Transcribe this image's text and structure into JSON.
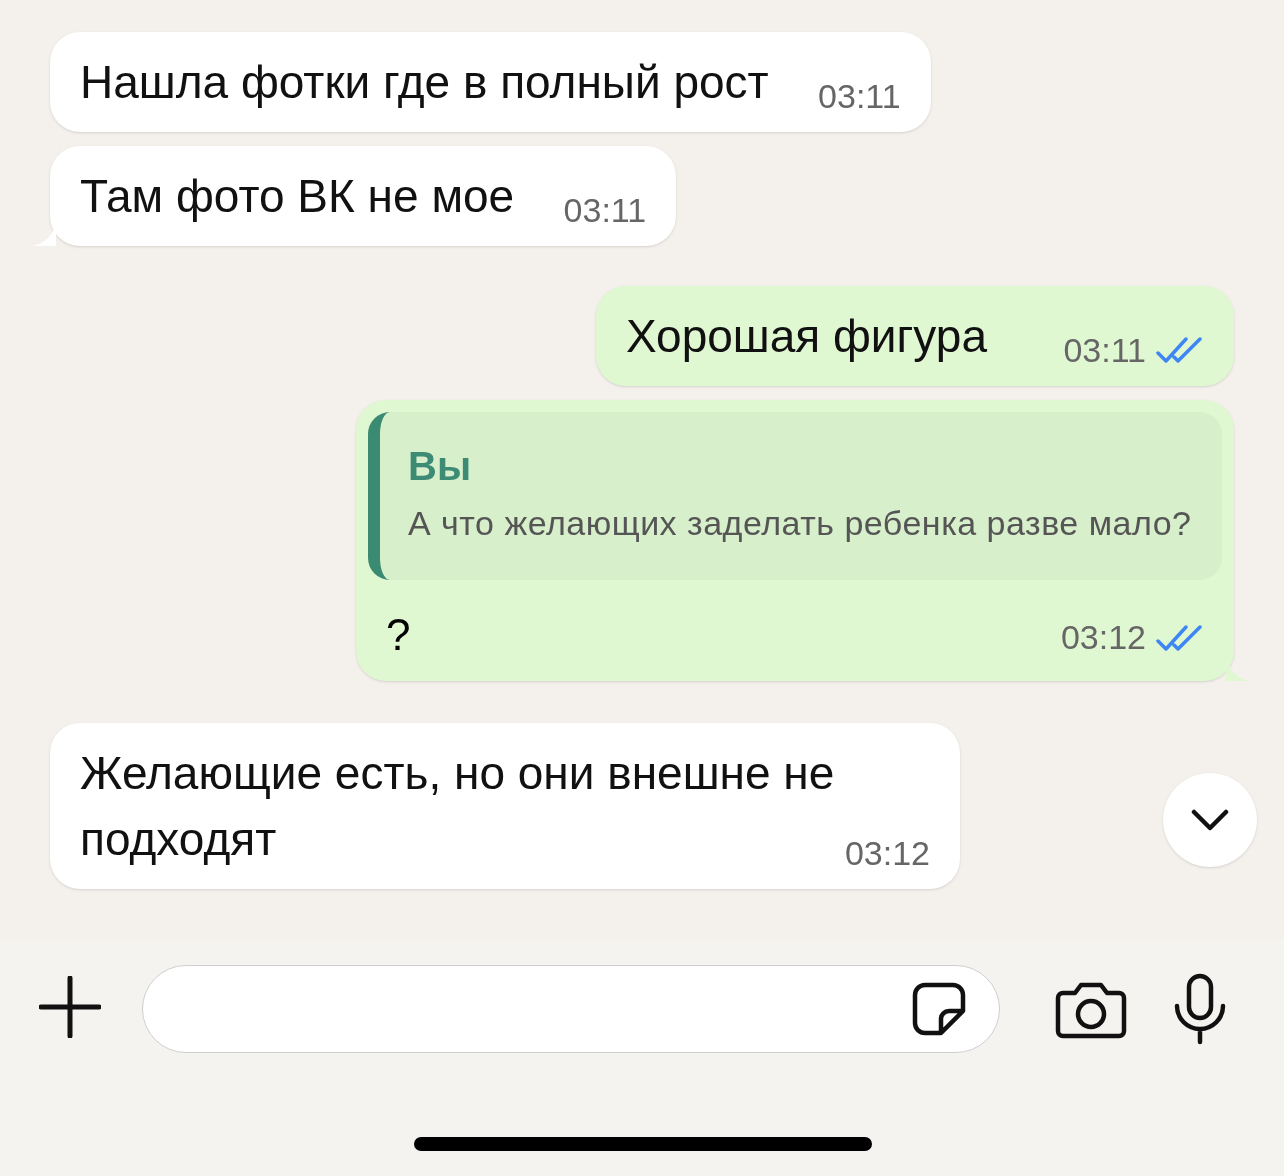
{
  "messages": [
    {
      "kind": "incoming",
      "text": "Нашла фотки где в полный рост",
      "time": "03:11",
      "tail": false
    },
    {
      "kind": "incoming",
      "text": "Там фото ВК не мое",
      "time": "03:11",
      "tail": true
    },
    {
      "kind": "outgoing",
      "text": "Хорошая фигура",
      "time": "03:11",
      "read": true,
      "tail": false
    },
    {
      "kind": "outgoing",
      "quote": {
        "author": "Вы",
        "text": "А что желающих заделать ребенка разве мало?"
      },
      "text": "?",
      "time": "03:12",
      "read": true,
      "tail": true
    },
    {
      "kind": "incoming",
      "text": "Желающие есть, но они внешне не подходят",
      "time": "03:12",
      "tail": false
    }
  ]
}
